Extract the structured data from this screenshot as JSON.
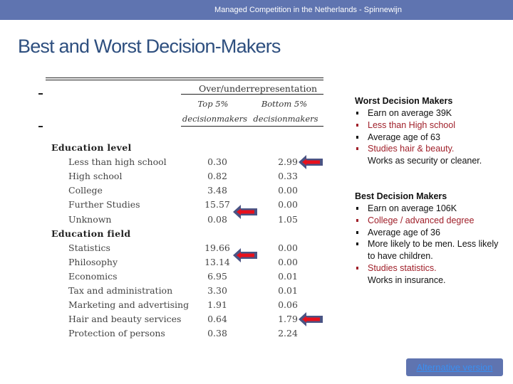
{
  "header": {
    "text": "Managed Competition in the Netherlands - Spinnewijn",
    "bar_color": "#5f74b0"
  },
  "title": "Best and Worst Decision-Makers",
  "table": {
    "group_header": "Over/underrepresentation",
    "columns": [
      {
        "line1": "Top 5%",
        "line2": "decisionmakers"
      },
      {
        "line1": "Bottom 5%",
        "line2": "decisionmakers"
      }
    ],
    "sections": [
      {
        "title": "Education level",
        "rows": [
          {
            "label": "Less than high school",
            "top": "0.30",
            "bottom": "2.99"
          },
          {
            "label": "High school",
            "top": "0.82",
            "bottom": "0.33"
          },
          {
            "label": "College",
            "top": "3.48",
            "bottom": "0.00"
          },
          {
            "label": "Further Studies",
            "top": "15.57",
            "bottom": "0.00"
          },
          {
            "label": "Unknown",
            "top": "0.08",
            "bottom": "1.05"
          }
        ]
      },
      {
        "title": "Education field",
        "rows": [
          {
            "label": "Statistics",
            "top": "19.66",
            "bottom": "0.00"
          },
          {
            "label": "Philosophy",
            "top": "13.14",
            "bottom": "0.00"
          },
          {
            "label": "Economics",
            "top": "6.95",
            "bottom": "0.01"
          },
          {
            "label": "Tax and administration",
            "top": "3.30",
            "bottom": "0.01"
          },
          {
            "label": "Marketing and advertising",
            "top": "1.91",
            "bottom": "0.06"
          },
          {
            "label": "Hair and beauty services",
            "top": "0.64",
            "bottom": "1.79"
          },
          {
            "label": "Protection of persons",
            "top": "0.38",
            "bottom": "2.24"
          }
        ]
      }
    ],
    "highlight_arrows": [
      {
        "row": "Less than high school",
        "column": "bottom"
      },
      {
        "row": "Further Studies",
        "column": "top"
      },
      {
        "row": "Statistics",
        "column": "top"
      },
      {
        "row": "Hair and beauty services",
        "column": "bottom"
      }
    ]
  },
  "worst": {
    "heading": "Worst Decision Makers",
    "items": [
      {
        "text": "Earn on average 39K",
        "highlight": false
      },
      {
        "text": "Less than High school",
        "highlight": true
      },
      {
        "text": "Average age of 63",
        "highlight": false
      },
      {
        "text": "Studies hair & beauty.",
        "cont": "Works as security or cleaner.",
        "highlight": true
      }
    ]
  },
  "best": {
    "heading": "Best Decision Makers",
    "items": [
      {
        "text": "Earn on average 106K",
        "highlight": false
      },
      {
        "text": "College / advanced degree",
        "highlight": true
      },
      {
        "text": "Average age of 36",
        "highlight": false
      },
      {
        "text": "More likely to be men. Less likely to have children.",
        "highlight": false
      },
      {
        "text": "Studies statistics.",
        "cont": "Works in insurance.",
        "highlight": true
      }
    ]
  },
  "colors": {
    "highlight_text": "#a0202a",
    "arrow_fill": "#e8101c",
    "arrow_border": "#4a5484"
  },
  "alt_button": {
    "label": "Alternative version"
  }
}
